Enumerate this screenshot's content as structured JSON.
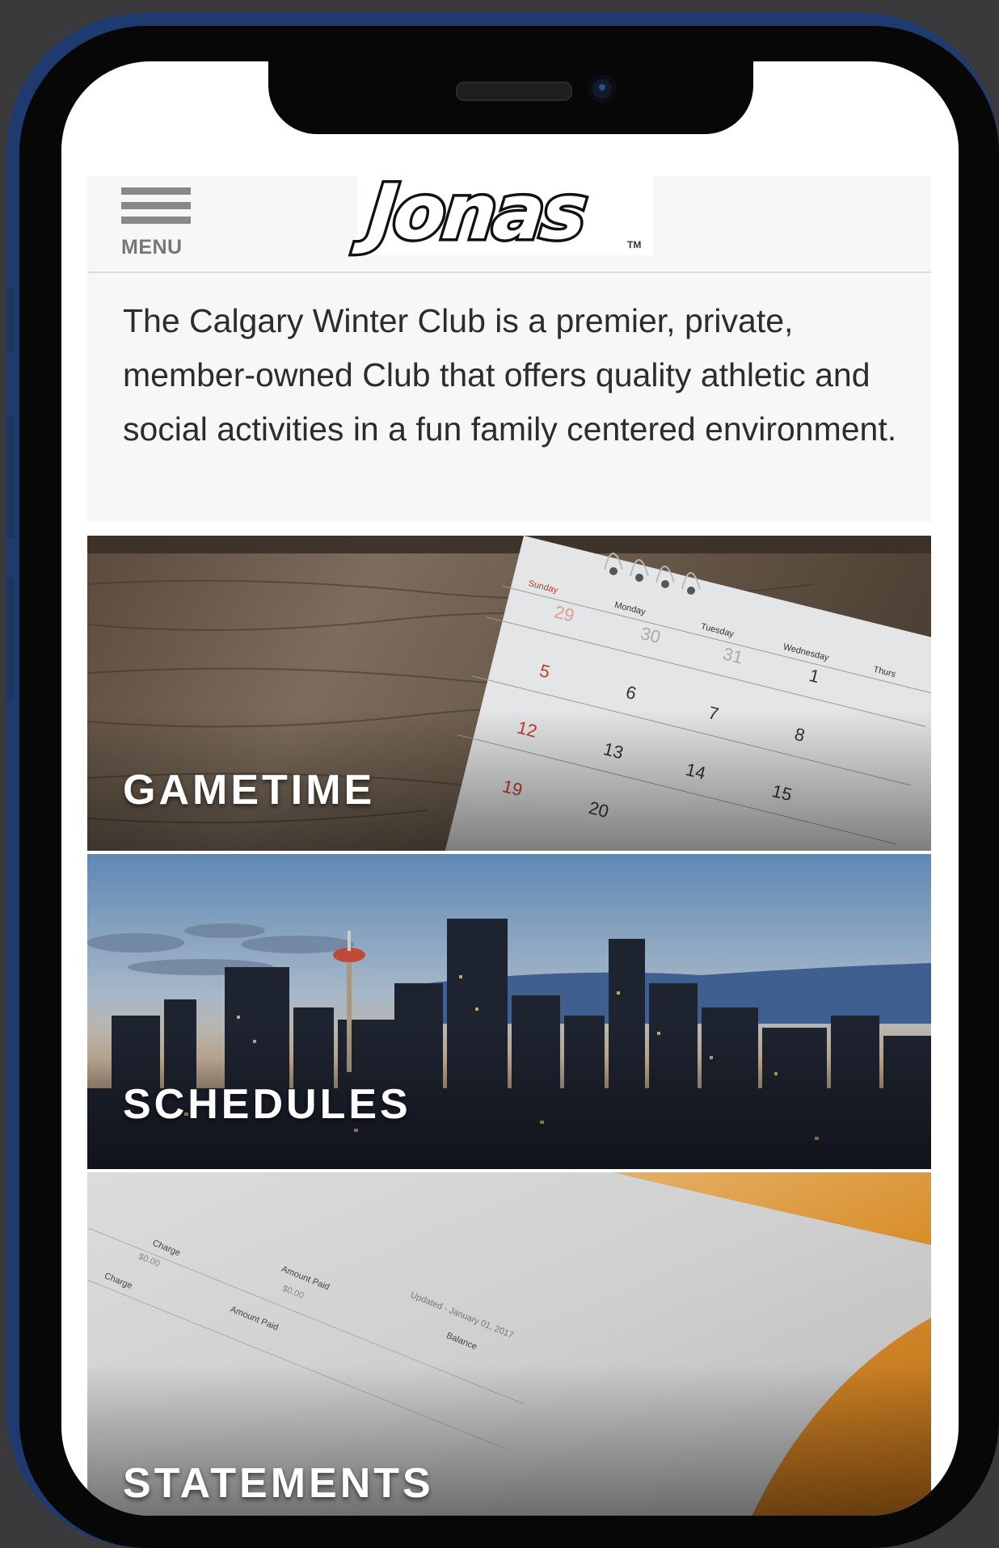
{
  "header": {
    "menu_label": "MENU",
    "logo_text": "Jonas",
    "logo_tm": "TM"
  },
  "intro": {
    "text": "The Calgary Winter Club is a premier, private, member-owned Club that offers quality athletic and social activities in a fun family centered environment."
  },
  "tiles": [
    {
      "label": "GAMETIME"
    },
    {
      "label": "SCHEDULES"
    },
    {
      "label": "STATEMENTS"
    }
  ],
  "calendar": {
    "days": [
      "Sunday",
      "Monday",
      "Tuesday",
      "Wednesday",
      "Thurs"
    ],
    "rows": [
      [
        "29",
        "30",
        "31",
        "1"
      ],
      [
        "5",
        "6",
        "7",
        "8"
      ],
      [
        "12",
        "13",
        "14",
        "15"
      ],
      [
        "19",
        "20"
      ]
    ]
  },
  "statement": {
    "labels": [
      "Charge",
      "Amount Paid",
      "Charge",
      "Amount Paid",
      "Updated - January 01, 2017",
      "Balance"
    ],
    "amounts": [
      "$0.00",
      "$0.00"
    ]
  },
  "colors": {
    "phone_frame": "#1f3a6e",
    "header_bg": "#f7f7f7",
    "calendar_red": "#c0392b"
  }
}
